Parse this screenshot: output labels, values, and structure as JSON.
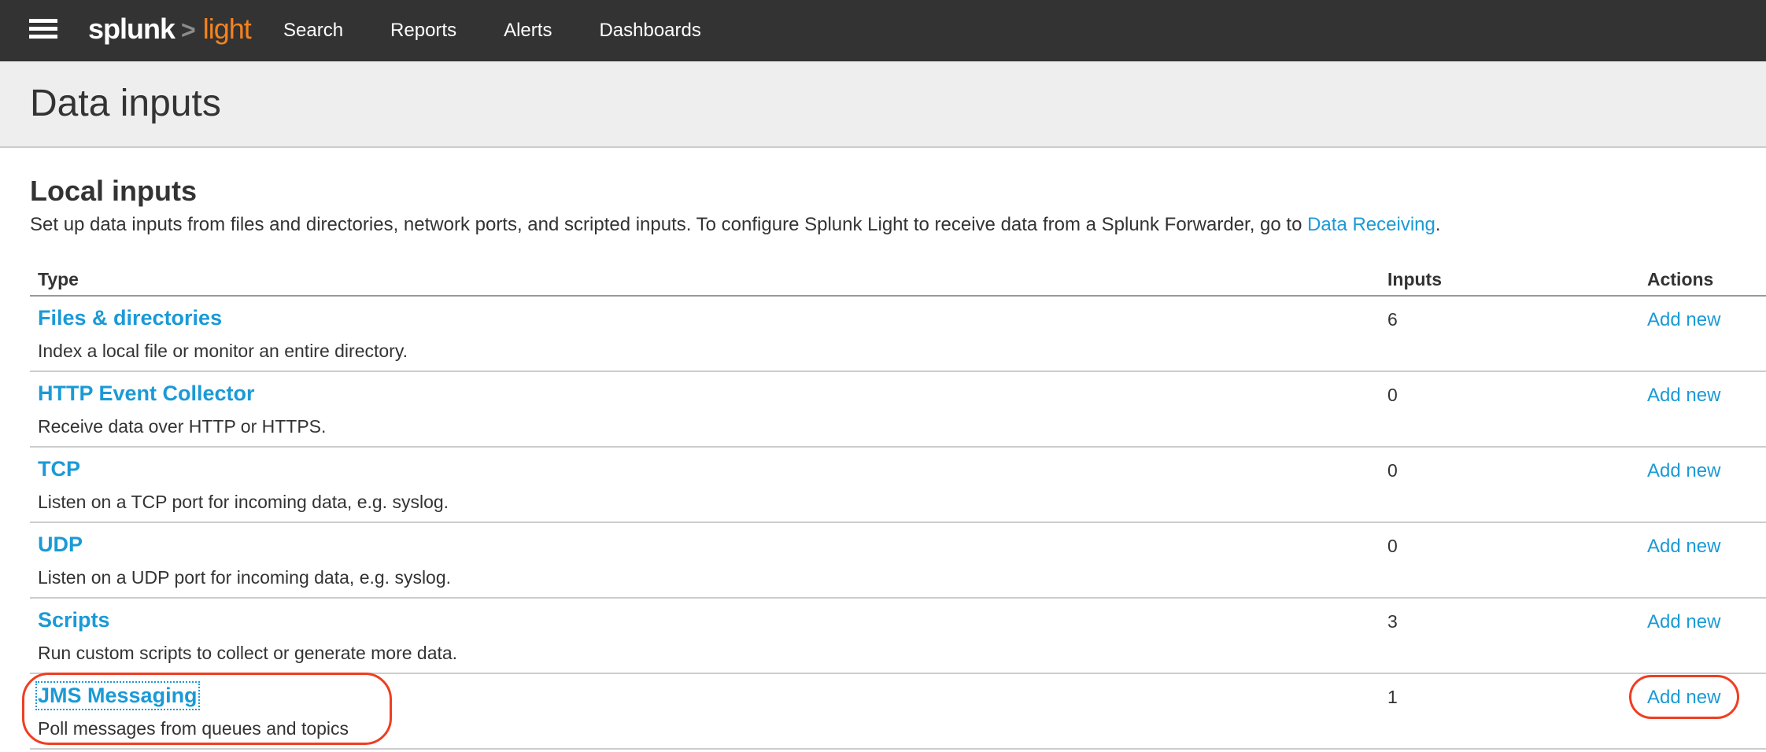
{
  "nav": {
    "menu_icon": "hamburger-menu-icon",
    "logo": {
      "brand": "splunk",
      "separator": ">",
      "product": "light"
    },
    "links": [
      {
        "label": "Search"
      },
      {
        "label": "Reports"
      },
      {
        "label": "Alerts"
      },
      {
        "label": "Dashboards"
      }
    ]
  },
  "page": {
    "title": "Data inputs"
  },
  "section": {
    "title": "Local inputs",
    "description_prefix": "Set up data inputs from files and directories, network ports, and scripted inputs. To configure Splunk Light to receive data from a Splunk Forwarder, go to ",
    "description_link": "Data Receiving",
    "description_suffix": "."
  },
  "table": {
    "columns": {
      "type": "Type",
      "inputs": "Inputs",
      "actions": "Actions"
    },
    "rows": [
      {
        "name": "Files & directories",
        "description": "Index a local file or monitor an entire directory.",
        "inputs": "6",
        "action": "Add new"
      },
      {
        "name": "HTTP Event Collector",
        "description": "Receive data over HTTP or HTTPS.",
        "inputs": "0",
        "action": "Add new"
      },
      {
        "name": "TCP",
        "description": "Listen on a TCP port for incoming data, e.g. syslog.",
        "inputs": "0",
        "action": "Add new"
      },
      {
        "name": "UDP",
        "description": "Listen on a UDP port for incoming data, e.g. syslog.",
        "inputs": "0",
        "action": "Add new"
      },
      {
        "name": "Scripts",
        "description": "Run custom scripts to collect or generate more data.",
        "inputs": "3",
        "action": "Add new"
      },
      {
        "name": "JMS Messaging",
        "description": "Poll messages from queues and topics",
        "inputs": "1",
        "action": "Add new"
      }
    ]
  },
  "colors": {
    "nav_bg": "#333333",
    "brand_orange": "#f58220",
    "link_blue": "#1a9ad6",
    "header_bg": "#eeeeee",
    "annotation_red": "#ef3e22"
  }
}
